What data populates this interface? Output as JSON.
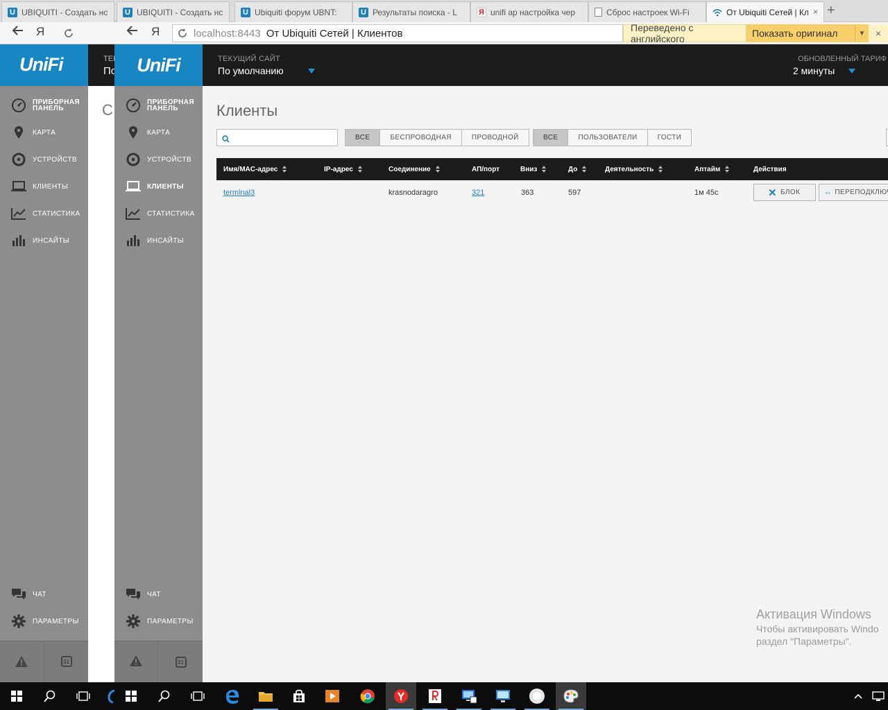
{
  "browser": {
    "tabs": [
      {
        "label": "UBIQUITI - Создать нс",
        "icon": "ubiquiti-icon"
      },
      {
        "label": "UBIQUITI - Создать нс",
        "icon": "ubiquiti-icon"
      },
      {
        "label": "Ubiquiti форум UBNT:",
        "icon": "ubiquiti-icon"
      },
      {
        "label": "Результаты поиска - L",
        "icon": "ubiquiti-icon"
      },
      {
        "label": "unifi ap настройка чер",
        "icon": "yandex-icon"
      },
      {
        "label": "Сброс настроек Wi-Fi",
        "icon": "document-icon"
      },
      {
        "label": "От Ubiquiti Сетей | Кл",
        "icon": "wifi-icon"
      }
    ],
    "tab_close": "×",
    "new_tab": "+",
    "address": {
      "host": "localhost:8443",
      "title": "От Ubiquiti Сетей | Клиентов"
    },
    "ghost_address": "localhost",
    "yandex_label": "Я",
    "translation": {
      "note": "Переведено с английского",
      "show_original": "Показать оригинал",
      "close": "×"
    }
  },
  "ghost": {
    "header_label": "ТЕК",
    "header_value": "По",
    "title": "С"
  },
  "app": {
    "logo": "UniFi",
    "header": {
      "site_label": "ТЕКУЩИЙ САЙТ",
      "site_value": "По умолчанию",
      "rate_label": "ОБНОВЛЕННЫЙ ТАРИФ",
      "rate_value": "2 минуты"
    },
    "nav": [
      {
        "label": "ПРИБОРНАЯ ПАНЕЛЬ",
        "icon": "dashboard-gauge-icon"
      },
      {
        "label": "КАРТА",
        "icon": "map-pin-icon"
      },
      {
        "label": "УСТРОЙСТВ",
        "icon": "devices-circle-icon"
      },
      {
        "label": "КЛИЕНТЫ",
        "icon": "laptop-icon"
      },
      {
        "label": "СТАТИСТИКА",
        "icon": "line-chart-icon"
      },
      {
        "label": "ИНСАЙТЫ",
        "icon": "bar-chart-icon"
      }
    ],
    "nav_bottom": [
      {
        "label": "ЧАТ",
        "icon": "chat-bubbles-icon"
      },
      {
        "label": "ПАРАМЕТРЫ",
        "icon": "gear-icon"
      }
    ],
    "footer": {
      "alerts_icon": "warning-icon",
      "calendar_day": "31"
    }
  },
  "clients": {
    "title": "Клиенты",
    "search_placeholder": "",
    "filter_type": [
      "ВСЕ",
      "БЕСПРОВОДНАЯ",
      "ПРОВОДНОЙ"
    ],
    "filter_user": [
      "ВСЕ",
      "ПОЛЬЗОВАТЕЛИ",
      "ГОСТИ"
    ],
    "columns": [
      "Имя/MAC-адрес",
      "IP-адрес",
      "Соединение",
      "АП/порт",
      "Вниз",
      "До",
      "Деятельность",
      "Аптайм",
      "Действия"
    ],
    "rows": [
      {
        "name": "terminal3",
        "ip": "",
        "connection": "krasnodaragro",
        "ap_port": "321",
        "down": "363",
        "up": "597",
        "activity": "",
        "uptime": "1м 45с"
      }
    ],
    "actions": {
      "block": "БЛОК",
      "reconnect": "ПЕРЕПОДКЛЮЧ"
    }
  },
  "windows_activation": {
    "title": "Активация Windows",
    "line1": "Чтобы активировать Windo",
    "line2": "раздел \"Параметры\"."
  },
  "colors": {
    "accent": "#1786c3",
    "header_bg": "#1b1b1b",
    "sidebar_bg": "#8b8d8f",
    "content_bg": "#f4f4f4",
    "link": "#1c80b9"
  }
}
